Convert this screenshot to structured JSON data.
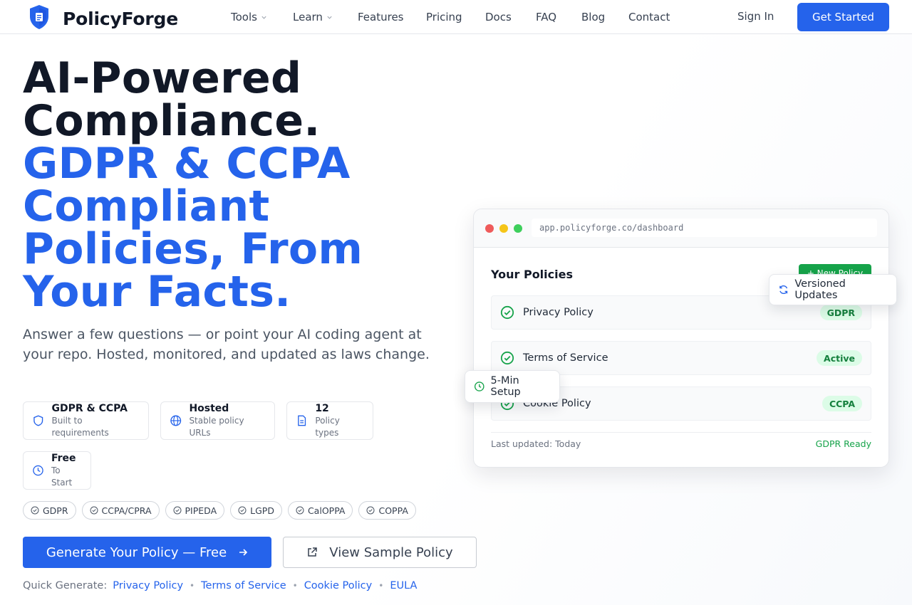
{
  "nav": {
    "brand": "PolicyForge",
    "links": [
      "Tools",
      "Learn",
      "Features",
      "Pricing",
      "Docs",
      "FAQ",
      "Blog",
      "Contact"
    ],
    "sign_in": "Sign In",
    "get_started": "Get Started"
  },
  "hero": {
    "headline_dark": [
      "AI-Powered",
      "Compliance."
    ],
    "headline_blue": [
      "GDPR & CCPA",
      "Compliant",
      "Policies, From",
      "Your Facts."
    ],
    "subtitle": "Answer a few questions — or point your AI coding agent at your repo. Hosted, monitored, and updated as laws change.",
    "features": [
      {
        "title": "GDPR & CCPA",
        "caption": "Built to requirements",
        "icon": "shield-icon"
      },
      {
        "title": "Hosted",
        "caption": "Stable policy URLs",
        "icon": "globe-icon"
      },
      {
        "title": "12",
        "caption": "Policy types",
        "icon": "document-icon"
      },
      {
        "title": "Free",
        "caption": "To Start",
        "icon": "clock-icon"
      }
    ],
    "laws": [
      "GDPR",
      "CCPA/CPRA",
      "PIPEDA",
      "LGPD",
      "CalOPPA",
      "COPPA"
    ],
    "cta_primary": "Generate Your Policy — Free",
    "cta_secondary": "View Sample Policy",
    "quick_label": "Quick Generate:",
    "quick_links": [
      "Privacy Policy",
      "Terms of Service",
      "Cookie Policy",
      "EULA"
    ]
  },
  "mock": {
    "url": "app.policyforge.co/dashboard",
    "title": "Your Policies",
    "new_button": "+ New Policy",
    "rows": [
      {
        "label": "Privacy Policy",
        "badge": "GDPR"
      },
      {
        "label": "Terms of Service",
        "badge": "Active"
      },
      {
        "label": "Cookie Policy",
        "badge": "CCPA"
      }
    ],
    "footer_left": "Last updated: Today",
    "footer_right": "GDPR Ready",
    "float_versioned": "Versioned Updates",
    "float_setup": "5-Min Setup"
  },
  "colors": {
    "accent": "#2563eb",
    "success": "#16a34a",
    "badge_bg": "#dcfce7",
    "traffic_red": "#ef5b5b",
    "traffic_yellow": "#f5c518",
    "traffic_green": "#3ecf5c"
  }
}
